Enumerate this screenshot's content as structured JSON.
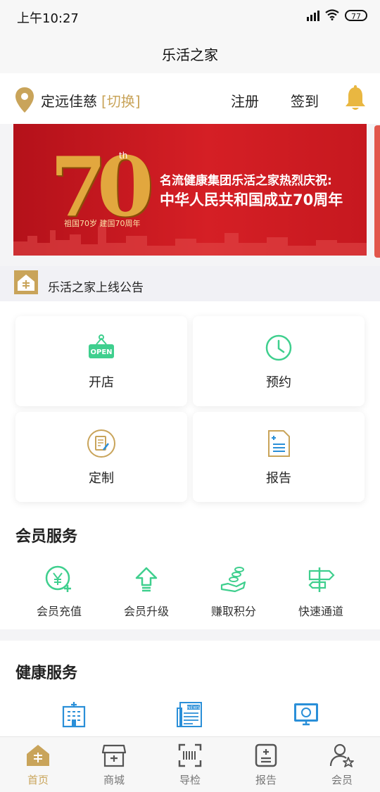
{
  "status": {
    "time": "上午10:27",
    "battery": "77"
  },
  "nav": {
    "title": "乐活之家"
  },
  "location": {
    "name": "定远佳慈",
    "switch": "[切换]"
  },
  "actions": {
    "register": "注册",
    "signin": "签到"
  },
  "banner": {
    "big": "70",
    "sup": "th",
    "small": "祖国70岁 建国70周年",
    "line1": "名流健康集团乐活之家热烈庆祝:",
    "line2": "中华人民共和国成立70周年"
  },
  "notice": {
    "text": "乐活之家上线公告"
  },
  "quick": [
    {
      "label": "开店",
      "icon": "open-sign-icon"
    },
    {
      "label": "预约",
      "icon": "clock-icon"
    },
    {
      "label": "定制",
      "icon": "custom-document-icon"
    },
    {
      "label": "报告",
      "icon": "report-icon"
    }
  ],
  "member_services": {
    "title": "会员服务",
    "items": [
      {
        "label": "会员充值",
        "icon": "yen-plus-icon"
      },
      {
        "label": "会员升级",
        "icon": "upgrade-arrow-icon"
      },
      {
        "label": "赚取积分",
        "icon": "earn-points-hand-icon"
      },
      {
        "label": "快速通道",
        "icon": "signpost-icon"
      }
    ]
  },
  "health_services": {
    "title": "健康服务",
    "icons": [
      "hospital-icon",
      "news-icon",
      "monitor-icon"
    ]
  },
  "tabs": [
    {
      "label": "首页",
      "icon": "home-icon",
      "active": true
    },
    {
      "label": "商城",
      "icon": "shop-icon"
    },
    {
      "label": "导检",
      "icon": "scan-icon"
    },
    {
      "label": "报告",
      "icon": "report-tab-icon"
    },
    {
      "label": "会员",
      "icon": "member-icon"
    }
  ],
  "colors": {
    "accent": "#c9a45a",
    "green": "#3fcf8e",
    "blue": "#2a8fd8",
    "banner_red": "#c6181f"
  }
}
